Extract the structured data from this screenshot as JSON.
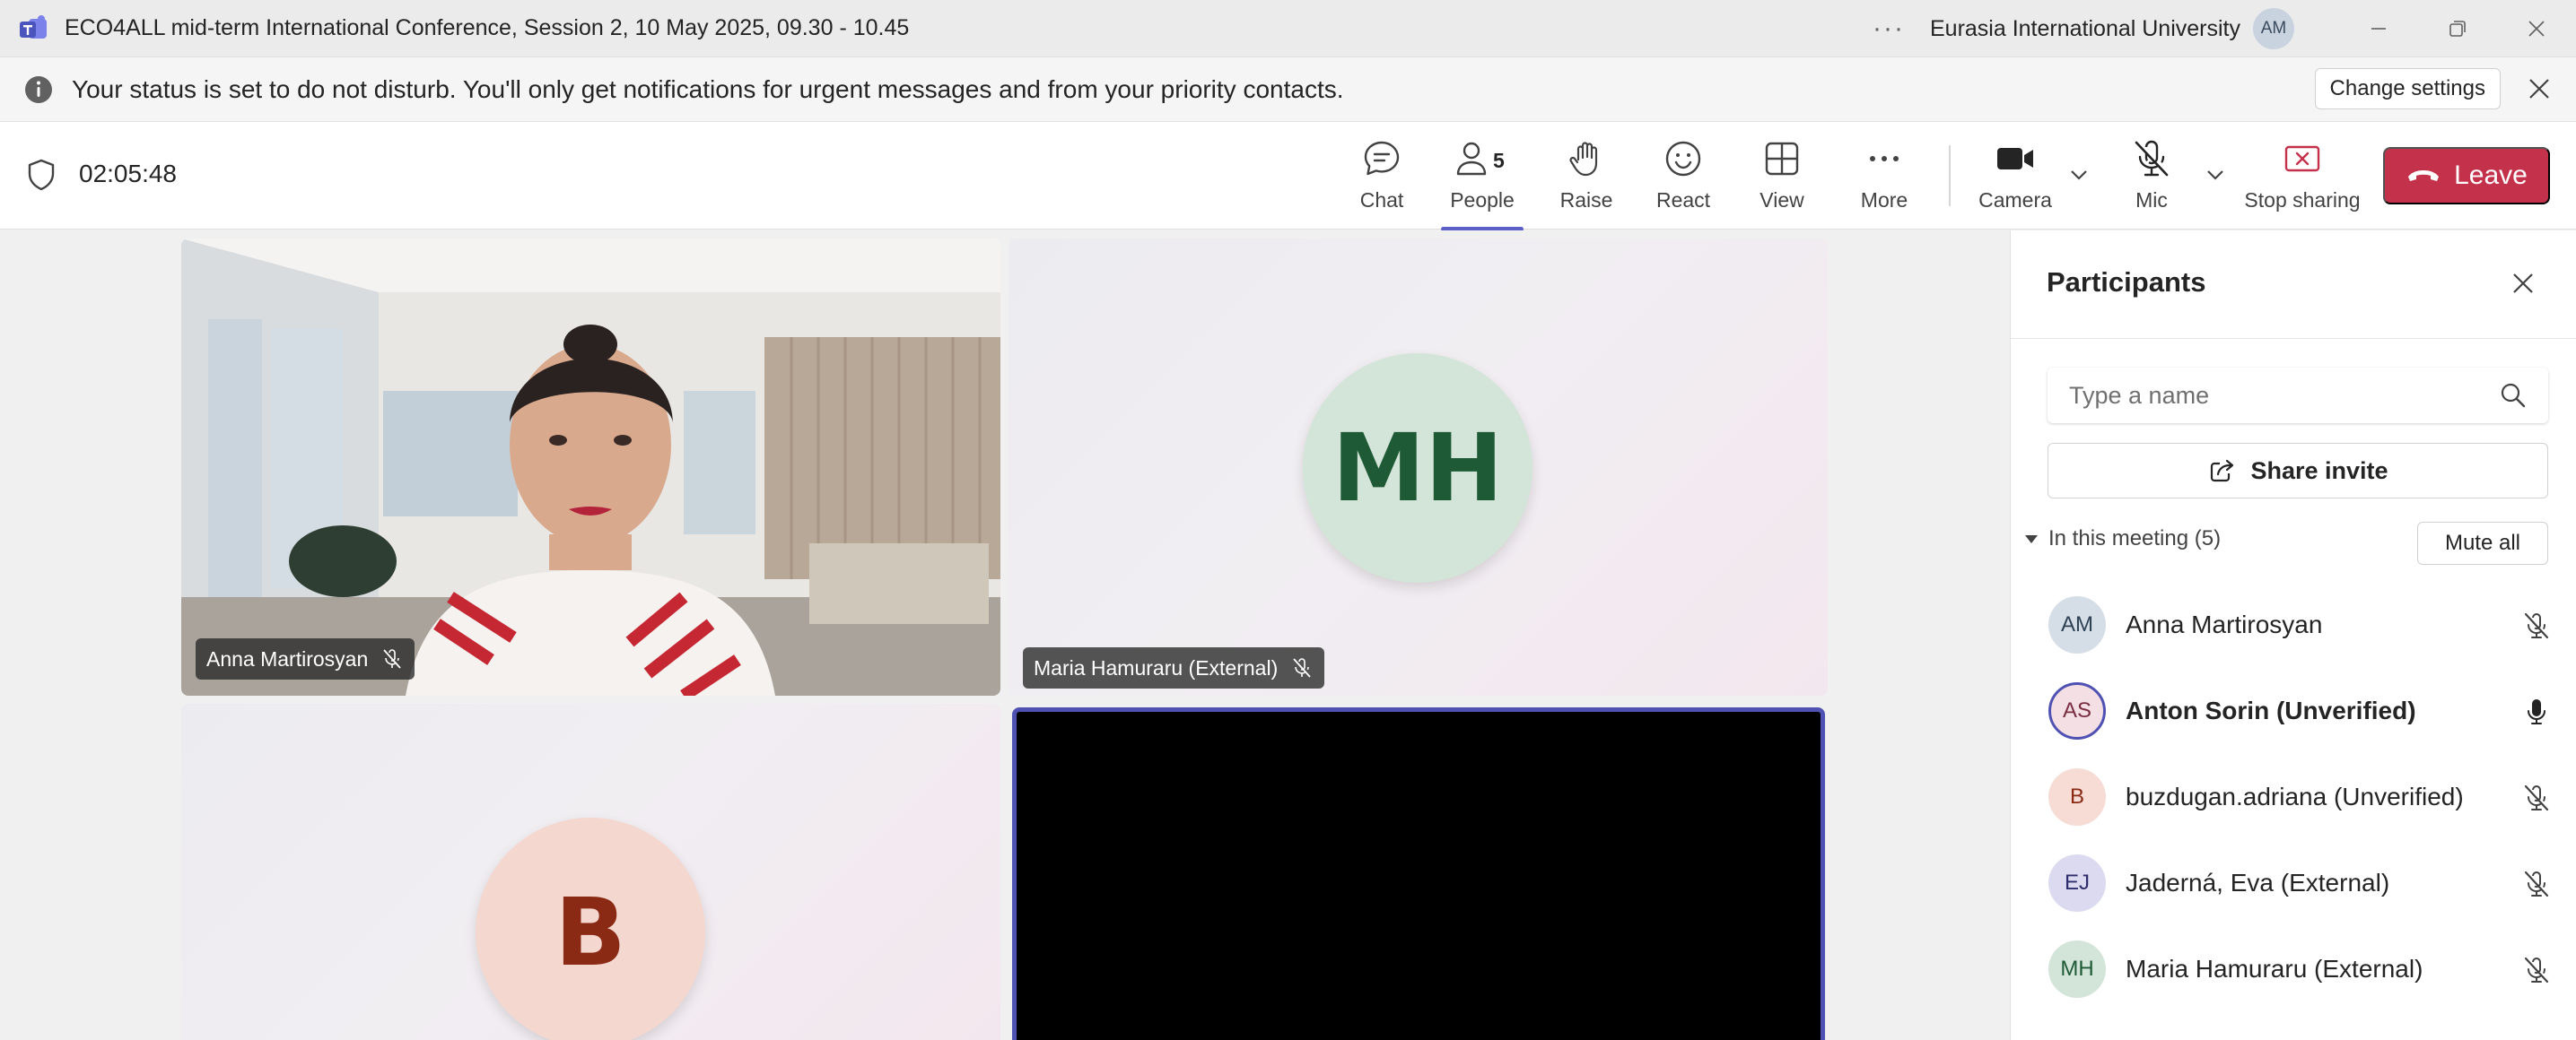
{
  "window": {
    "title": "ECO4ALL mid-term International Conference, Session 2, 10 May 2025, 09.30 - 10.45",
    "more": "···",
    "org": "Eurasia International University",
    "user_initials": "AM"
  },
  "banner": {
    "text": "Your status is set to do not disturb. You'll only get notifications for urgent messages and from your priority contacts.",
    "change_settings": "Change settings"
  },
  "toolbar": {
    "timer": "02:05:48",
    "chat": "Chat",
    "people": "People",
    "people_count": "5",
    "raise": "Raise",
    "react": "React",
    "view": "View",
    "more": "More",
    "camera": "Camera",
    "mic": "Mic",
    "stop_sharing": "Stop sharing",
    "leave": "Leave"
  },
  "stage": {
    "tiles": [
      {
        "name": "Anna Martirosyan"
      },
      {
        "name": "Maria Hamuraru (External)",
        "initials": "MH"
      },
      {
        "initials": "B"
      }
    ]
  },
  "panel": {
    "title": "Participants",
    "search_placeholder": "Type a name",
    "share_invite": "Share invite",
    "section": "In this meeting (5)",
    "mute_all": "Mute all",
    "participants": [
      {
        "initials": "AM",
        "name": "Anna Martirosyan",
        "suffix": "",
        "mic": "muted"
      },
      {
        "initials": "AS",
        "name": "Anton Sorin",
        "suffix": " (Unverified)",
        "mic": "on"
      },
      {
        "initials": "B",
        "name": "buzdugan.adriana",
        "suffix": " (Unverified)",
        "mic": "muted"
      },
      {
        "initials": "EJ",
        "name": "Jaderná, Eva",
        "suffix": " (External)",
        "mic": "muted"
      },
      {
        "initials": "MH",
        "name": "Maria Hamuraru",
        "suffix": " (External)",
        "mic": "muted"
      }
    ]
  },
  "colors": {
    "accent": "#5b5fc7",
    "leave": "#c4314b",
    "stop_sharing": "#c4314b"
  },
  "icons": [
    "teams-logo-icon",
    "more-icon",
    "minimize-icon",
    "restore-icon",
    "close-icon",
    "info-icon",
    "shield-icon",
    "chat-icon",
    "people-icon",
    "raise-hand-icon",
    "react-icon",
    "view-icon",
    "more-icon",
    "camera-icon",
    "mic-off-icon",
    "stop-sharing-icon",
    "phone-hangup-icon",
    "search-icon",
    "share-icon",
    "mic-icon"
  ]
}
